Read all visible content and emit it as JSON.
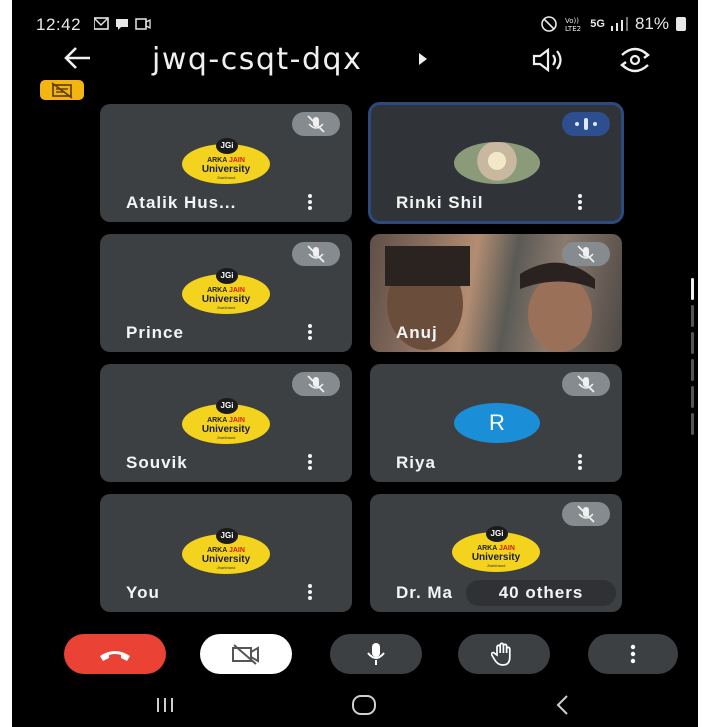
{
  "status_bar": {
    "time": "12:42",
    "battery": "81%",
    "network": "5G"
  },
  "header": {
    "meeting_code": "jwq-csqt-dqx"
  },
  "logo": {
    "badge": "JGi",
    "line1_a": "ARKA",
    "line1_b": "JAIN",
    "line2": "University",
    "line3": "Jharkhand"
  },
  "participants": [
    {
      "name": "Atalik Hus...",
      "type": "logo",
      "muted": true
    },
    {
      "name": "Rinki Shil",
      "type": "photo",
      "speaking": true
    },
    {
      "name": "Prince",
      "type": "logo",
      "muted": true
    },
    {
      "name": "Anuj",
      "type": "camera",
      "muted": true
    },
    {
      "name": "Souvik",
      "type": "logo",
      "muted": true
    },
    {
      "name": "Riya",
      "type": "initial",
      "initial": "R",
      "avatar_color": "#1a8fd8",
      "muted": true
    },
    {
      "name": "You",
      "type": "logo"
    },
    {
      "name": "Dr. Ma",
      "type": "logo",
      "muted": true
    }
  ],
  "others_label": "40 others",
  "colors": {
    "end_call": "#ea4335",
    "tile": "#3c4043",
    "active_border": "#2d4a7f",
    "logo_yellow": "#f3d31d"
  },
  "controls": [
    "end-call",
    "camera-off",
    "microphone",
    "raise-hand",
    "more-options"
  ]
}
